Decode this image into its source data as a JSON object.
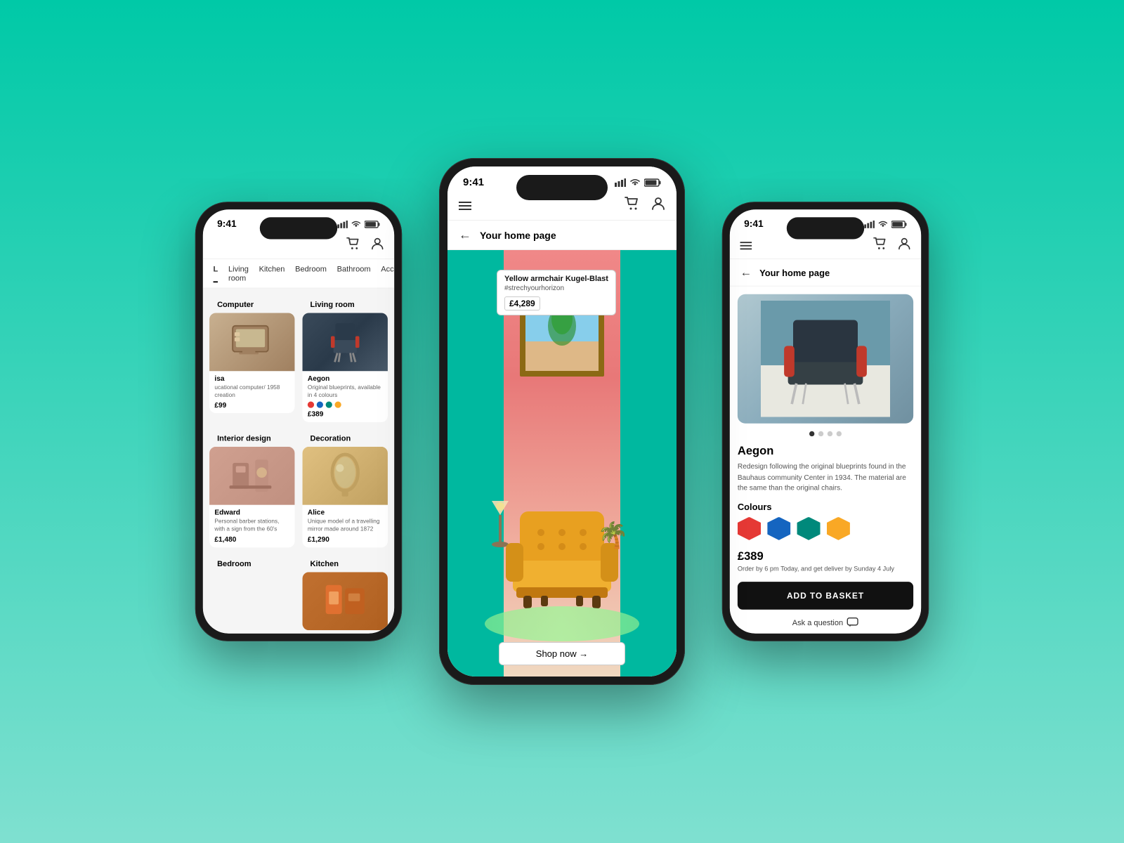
{
  "background": {
    "gradient_start": "#00C9A7",
    "gradient_end": "#7FE0D0"
  },
  "phones": {
    "left": {
      "status": {
        "time": "9:41",
        "signal": "▌▌▌",
        "wifi": "wifi",
        "battery": "battery"
      },
      "nav": {
        "cart_icon": "🛒",
        "person_icon": "👤"
      },
      "categories": [
        "L",
        "Living room",
        "Kitchen",
        "Bedroom",
        "Bathroom",
        "Acc..."
      ],
      "sections": [
        {
          "title": "Computer",
          "products": [
            {
              "name": "isa",
              "description": "ucational computer/ 1958 creation",
              "price": "£99",
              "has_image": true,
              "image_type": "computer"
            }
          ]
        },
        {
          "title": "Living room",
          "products": [
            {
              "name": "Aegon",
              "description": "Original blueprints, available in 4 colours",
              "price": "£389",
              "has_image": true,
              "image_type": "chair-dark",
              "colors": [
                "#e53935",
                "#1565c0",
                "#00897b",
                "#f9a825"
              ]
            }
          ]
        },
        {
          "title": "Interior design",
          "products": [
            {
              "name": "Edward",
              "description": "Personal barber stations, with a sign from the 60's",
              "price": "£1,480",
              "has_image": true,
              "image_type": "barber"
            }
          ]
        },
        {
          "title": "Decoration",
          "products": [
            {
              "name": "Alice",
              "description": "Unique model of a travelling mirror made around 1872",
              "price": "£1,290",
              "has_image": true,
              "image_type": "mirror"
            }
          ]
        },
        {
          "title": "Bedroom",
          "products": []
        },
        {
          "title": "Kitchen",
          "products": [
            {
              "name": "",
              "description": "",
              "price": "",
              "has_image": true,
              "image_type": "kitchen"
            }
          ]
        }
      ]
    },
    "center": {
      "status": {
        "time": "9:41"
      },
      "nav": {
        "hamburger": true,
        "cart_icon": "🛒",
        "person_icon": "👤"
      },
      "page_title": "Your home page",
      "hero": {
        "product_tag_name": "Yellow armchair Kugel-Blast",
        "product_tag_hashtag": "#strechyourhorizon",
        "product_tag_price": "£4,289"
      },
      "shop_now_label": "Shop now →"
    },
    "right": {
      "status": {
        "time": "9:41"
      },
      "nav": {
        "hamburger": true,
        "cart_icon": "🛒",
        "person_icon": "👤"
      },
      "page_title": "Your home page",
      "product": {
        "name": "Aegon",
        "description": "Redesign following the original blueprints found in the Bauhaus community Center in 1934. The material are the same than the original chairs.",
        "colours_label": "Colours",
        "colors": [
          {
            "name": "red",
            "hex": "#e53935"
          },
          {
            "name": "blue",
            "hex": "#1565c0"
          },
          {
            "name": "teal",
            "hex": "#00897b"
          },
          {
            "name": "yellow",
            "hex": "#f9a825"
          }
        ],
        "price": "£389",
        "delivery": "Order by 6 pm Today, and get deliver by Sunday 4 July",
        "add_to_basket": "ADD TO BASKET",
        "ask_question": "Ask a question",
        "dots": [
          true,
          false,
          false,
          false
        ]
      }
    }
  }
}
